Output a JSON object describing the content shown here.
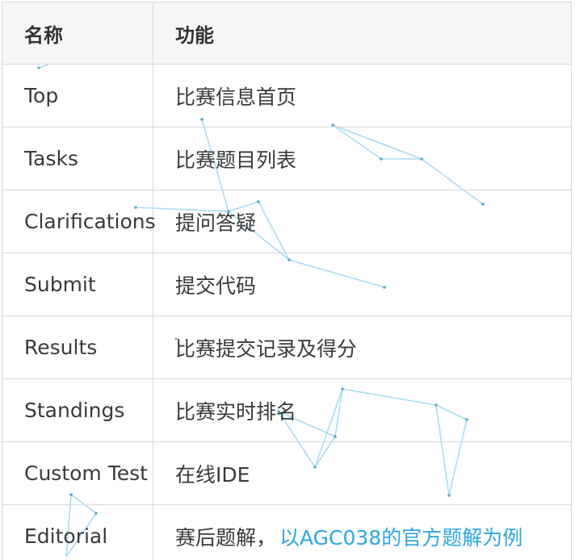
{
  "table": {
    "header": {
      "name": "名称",
      "function": "功能"
    },
    "rows": [
      {
        "name": "Top",
        "function": "比赛信息首页"
      },
      {
        "name": "Tasks",
        "function": "比赛题目列表"
      },
      {
        "name": "Clarifications",
        "function": "提问答疑"
      },
      {
        "name": "Submit",
        "function": "提交代码"
      },
      {
        "name": "Results",
        "function": "比赛提交记录及得分"
      },
      {
        "name": "Standings",
        "function": "比赛实时排名"
      },
      {
        "name": "Custom Test",
        "function": "在线IDE"
      },
      {
        "name": "Editorial",
        "function": "赛后题解，",
        "link": "以AGC038的官方题解为例"
      }
    ]
  },
  "colors": {
    "link": "#2ea6e3",
    "text": "#3a3a3a",
    "border": "#d7d7d7",
    "header_bg": "#f7f7f7",
    "background_network": "#8fd0ee"
  }
}
